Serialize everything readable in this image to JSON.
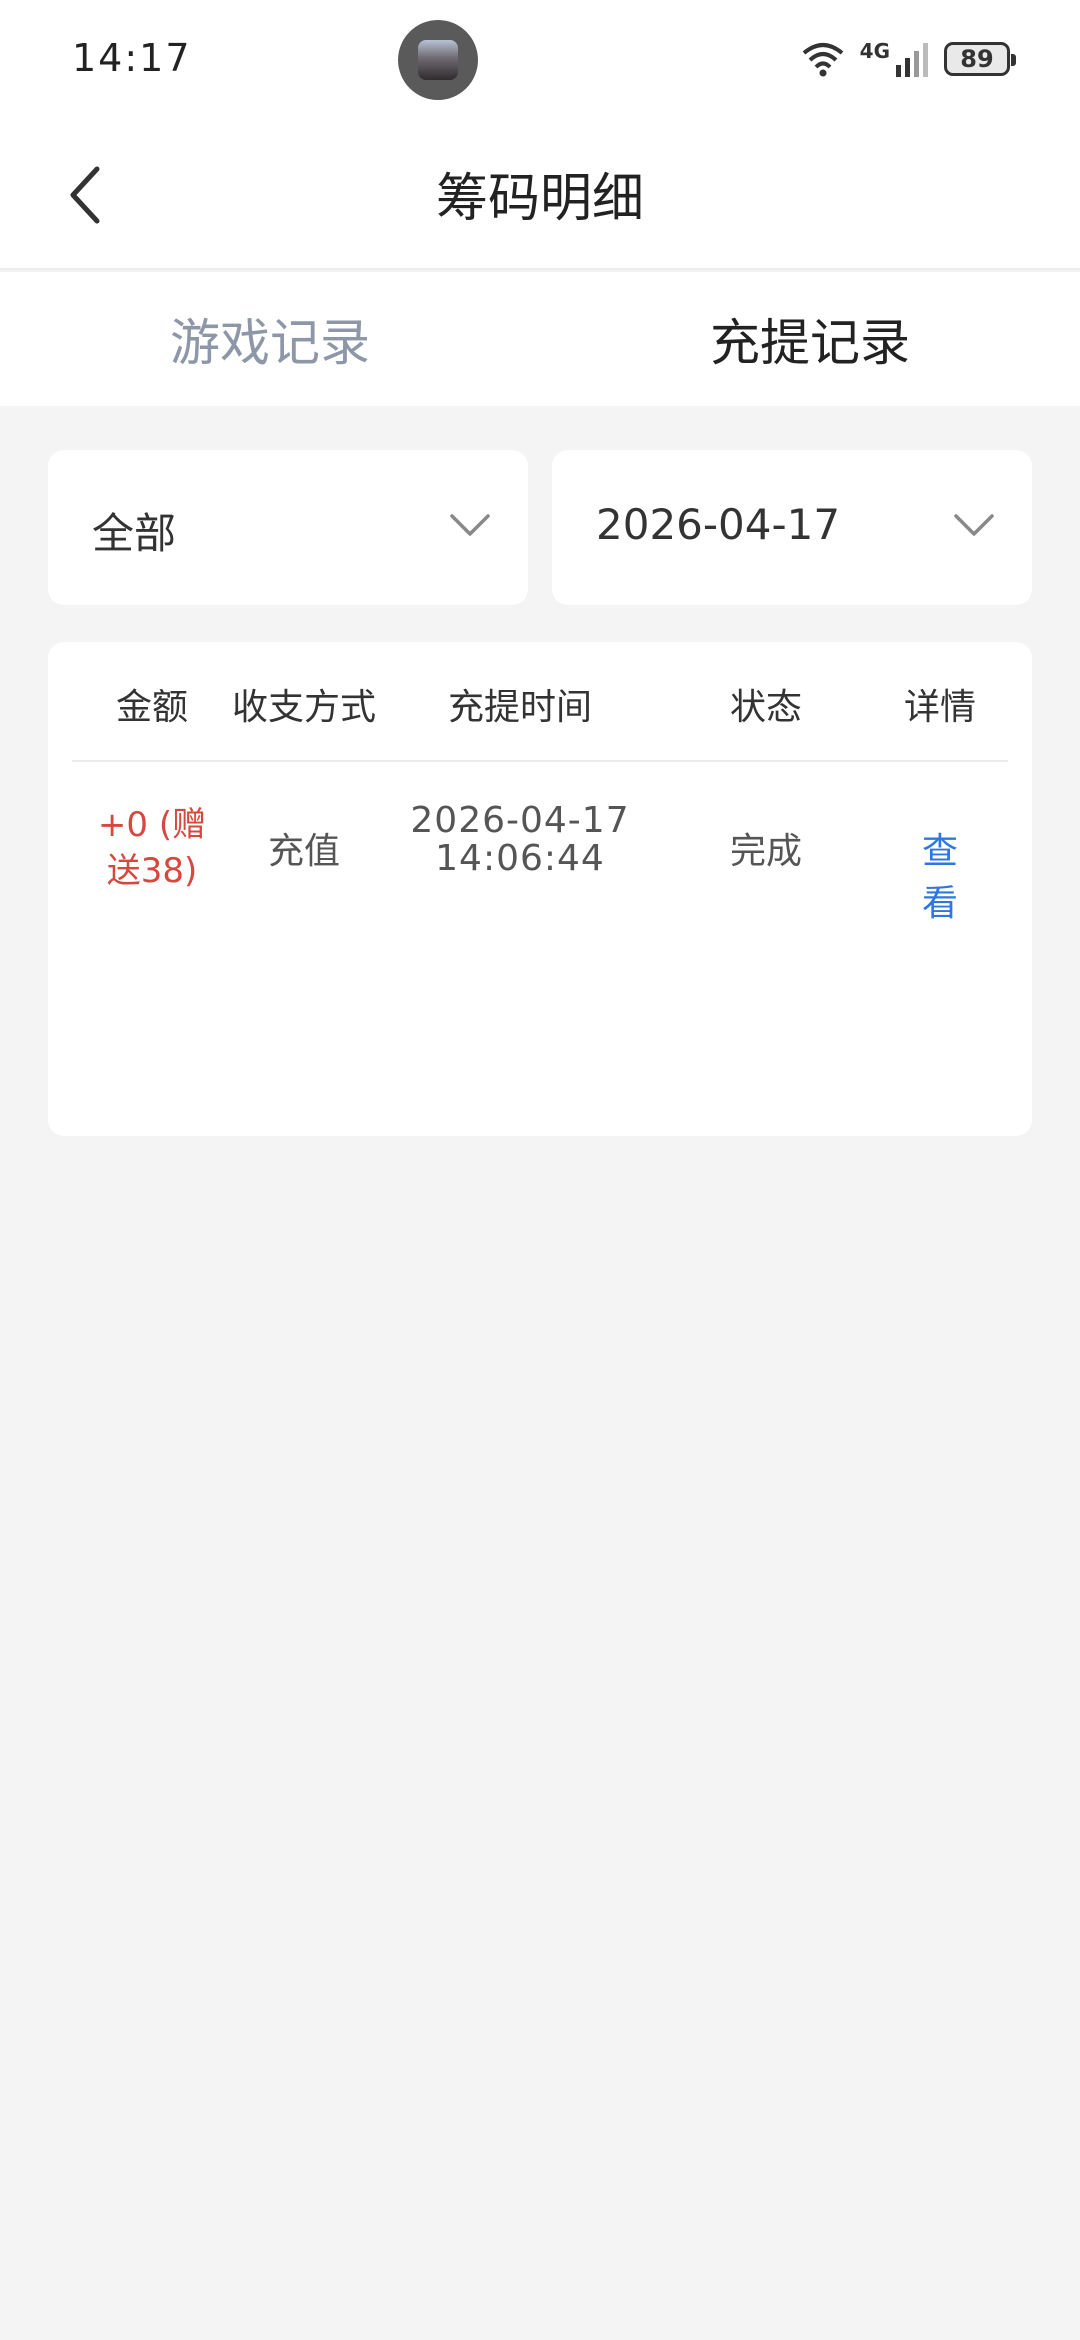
{
  "status_bar": {
    "time": "14:17",
    "battery": "89",
    "network": "4G",
    "icons": [
      "wifi-icon",
      "signal-icon",
      "battery-icon"
    ]
  },
  "header": {
    "title": "筹码明细",
    "back_icon": "chevron-left-icon"
  },
  "tabs": [
    {
      "label": "游戏记录",
      "active": false
    },
    {
      "label": "充提记录",
      "active": true
    }
  ],
  "filters": {
    "type": {
      "value": "全部",
      "icon": "chevron-down-icon"
    },
    "date": {
      "value": "2026-04-17",
      "icon": "chevron-down-icon"
    }
  },
  "table": {
    "columns": [
      "金额",
      "收支方式",
      "充提时间",
      "状态",
      "详情"
    ],
    "rows": [
      {
        "amount": "+0 (赠送38)",
        "method": "充值",
        "date": "2026-04-17",
        "time": "14:06:44",
        "status": "完成",
        "detail": "查看"
      }
    ]
  },
  "colors": {
    "accent_link": "#2f77e0",
    "amount_red": "#d8473d",
    "inactive_tab": "#8d97a8",
    "background": "#f4f4f4"
  }
}
